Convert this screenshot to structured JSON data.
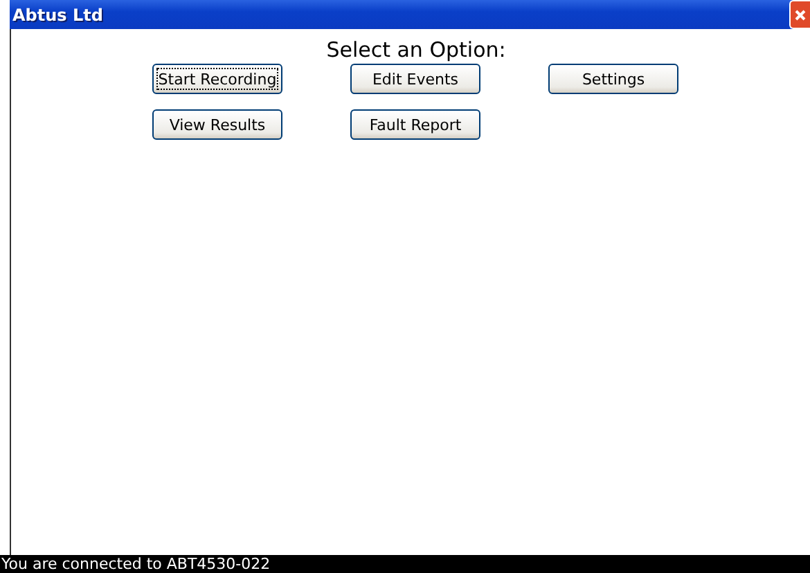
{
  "window": {
    "title": "Abtus Ltd"
  },
  "heading": "Select an Option:",
  "buttons": [
    {
      "label": "Start Recording",
      "focused": true
    },
    {
      "label": "Edit Events",
      "focused": false
    },
    {
      "label": "Settings",
      "focused": false
    },
    {
      "label": "View Results",
      "focused": false
    },
    {
      "label": "Fault Report",
      "focused": false
    }
  ],
  "status_bar": "You are connected to ABT4530-022"
}
